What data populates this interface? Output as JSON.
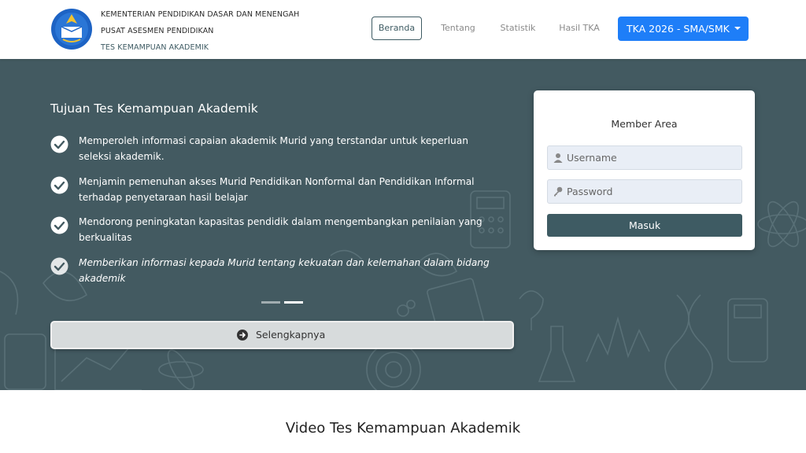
{
  "header": {
    "org_line1": "KEMENTERIAN PENDIDIKAN DASAR DAN MENENGAH",
    "org_line2": "PUSAT ASESMEN PENDIDIKAN",
    "org_line3": "TES KEMAMPUAN AKADEMIK",
    "logo_icon": "kemendikdasmen-logo-icon",
    "nav": [
      {
        "label": "Beranda",
        "active": true
      },
      {
        "label": "Tentang",
        "active": false
      },
      {
        "label": "Statistik",
        "active": false
      },
      {
        "label": "Hasil TKA",
        "active": false
      }
    ],
    "dropdown_label": "TKA 2026 - SMA/SMK"
  },
  "hero": {
    "title": "Tujuan Tes Kemampuan Akademik",
    "goals": [
      "Memperoleh informasi capaian akademik Murid yang terstandar untuk keperluan seleksi akademik.",
      "Menjamin pemenuhan akses Murid Pendidikan Nonformal dan Pendidikan Informal terhadap penyetaraan hasil belajar",
      "Mendorong peningkatan kapasitas pendidik dalam mengembangkan penilaian yang berkualitas",
      "Memberikan informasi kepada Murid tentang kekuatan dan kelemahan dalam bidang akademik"
    ],
    "more_button": "Selengkapnya",
    "more_icon": "arrow-circle-right-icon"
  },
  "login": {
    "title": "Member Area",
    "username_placeholder": "Username",
    "password_placeholder": "Password",
    "submit_label": "Masuk",
    "username_icon": "user-icon",
    "password_icon": "key-icon"
  },
  "section": {
    "video_title": "Video Tes Kemampuan Akademik"
  },
  "colors": {
    "primary": "#435a61",
    "accent": "#1e7ef8"
  }
}
